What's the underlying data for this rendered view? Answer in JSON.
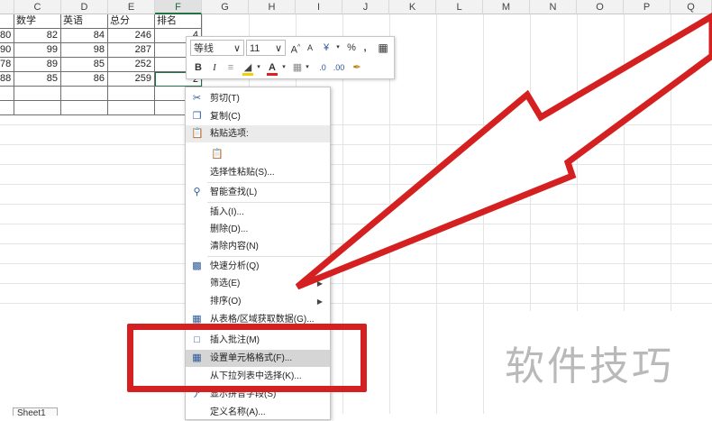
{
  "columns": [
    "C",
    "D",
    "E",
    "F",
    "G",
    "H",
    "I",
    "J",
    "K",
    "L",
    "M",
    "N",
    "O",
    "P",
    "Q"
  ],
  "selected_column": "F",
  "table": {
    "headers": [
      "数学",
      "英语",
      "总分",
      "排名"
    ],
    "row_prefixes": [
      "80",
      "90",
      "78",
      "88"
    ],
    "rows": [
      [
        "82",
        "84",
        "246",
        "4"
      ],
      [
        "99",
        "98",
        "287",
        "1"
      ],
      [
        "89",
        "85",
        "252",
        "3"
      ],
      [
        "85",
        "86",
        "259",
        "2"
      ]
    ]
  },
  "sheet_tab": "Sheet1",
  "mini_toolbar": {
    "font_name": "等线",
    "font_size": "11",
    "grow_font": "A",
    "shrink_font": "A",
    "currency": "¥",
    "percent": "%",
    "comma": ",",
    "bold": "B",
    "italic": "I",
    "font_color": "A"
  },
  "context_menu": {
    "items": [
      {
        "label": "剪切(T)",
        "icon": "scissors-icon"
      },
      {
        "label": "复制(C)",
        "icon": "copy-icon"
      },
      {
        "label": "粘贴选项:",
        "icon": "paste-icon"
      },
      {
        "label": "",
        "icon": "paste-option-icon"
      },
      {
        "label": "选择性粘贴(S)...",
        "icon": ""
      },
      {
        "label": "智能查找(L)",
        "icon": "search-icon"
      },
      {
        "label": "插入(I)...",
        "icon": ""
      },
      {
        "label": "删除(D)...",
        "icon": ""
      },
      {
        "label": "清除内容(N)",
        "icon": ""
      },
      {
        "label": "快速分析(Q)",
        "icon": "quick-analysis-icon"
      },
      {
        "label": "筛选(E)",
        "icon": ""
      },
      {
        "label": "排序(O)",
        "icon": ""
      },
      {
        "label": "从表格/区域获取数据(G)...",
        "icon": "table-icon"
      },
      {
        "label": "插入批注(M)",
        "icon": "comment-icon"
      },
      {
        "label": "设置单元格格式(F)...",
        "icon": "format-cells-icon"
      },
      {
        "label": "从下拉列表中选择(K)...",
        "icon": ""
      },
      {
        "label": "显示拼音字段(S)",
        "icon": "phonetic-icon"
      },
      {
        "label": "定义名称(A)...",
        "icon": ""
      }
    ]
  },
  "watermark": "软件技巧",
  "colors": {
    "accent": "#217346",
    "annotation_red": "#d42020",
    "highlight": "#d5d5d5"
  }
}
